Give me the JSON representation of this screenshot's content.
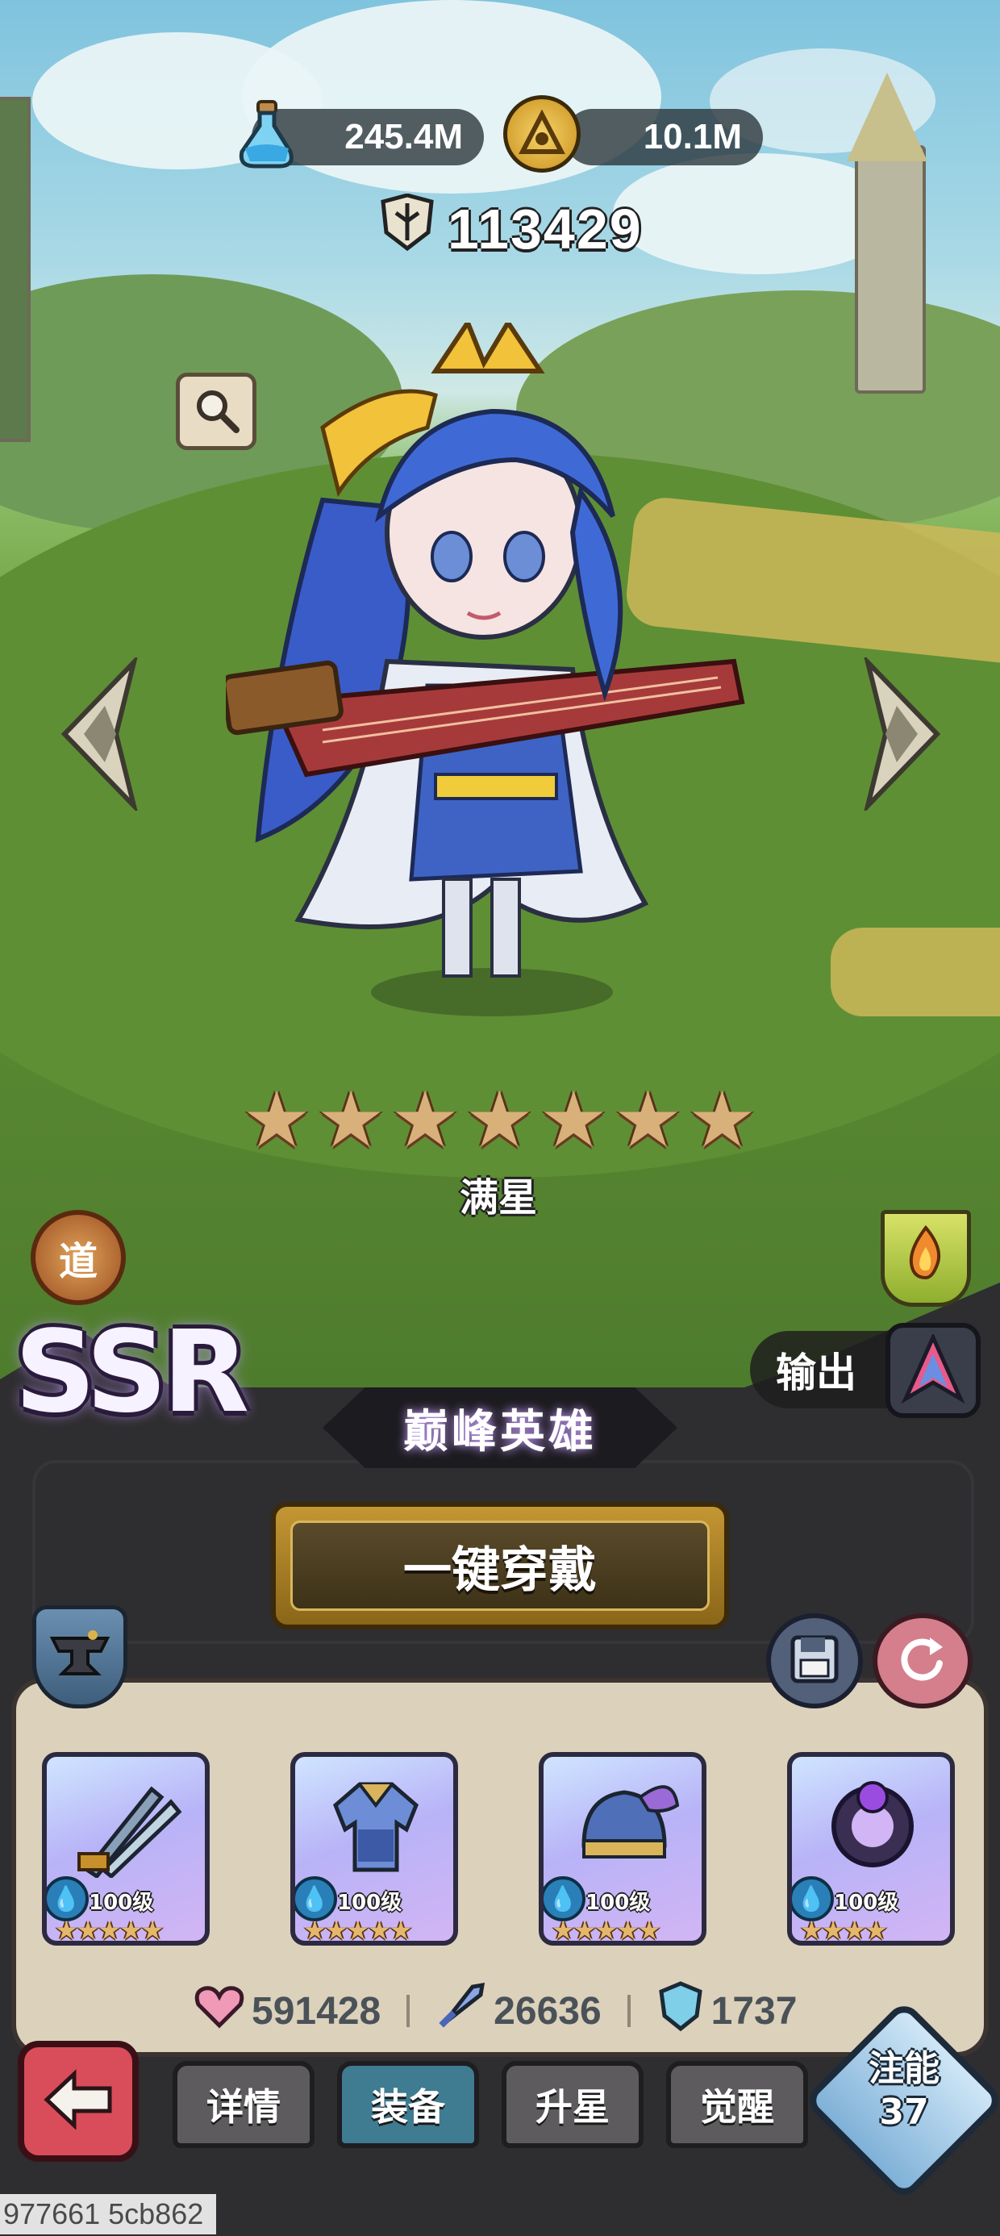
{
  "resources": {
    "potion": {
      "value": "245.4M",
      "icon": "potion-flask-icon"
    },
    "coin": {
      "value": "10.1M",
      "icon": "gold-coin-icon"
    }
  },
  "power": {
    "value": "113429",
    "icon": "power-crest-icon"
  },
  "hero": {
    "stars": 7,
    "star_label": "满星",
    "rarity": "SSR",
    "faction_badge": "道",
    "role_label": "输出",
    "title_banner": "巅峰英雄"
  },
  "actions": {
    "equip_all_label": "一键穿戴"
  },
  "equipment": [
    {
      "name": "weapon",
      "level": "100级",
      "stars": 5,
      "drop_icon": "water-drop-icon"
    },
    {
      "name": "armor",
      "level": "100级",
      "stars": 5,
      "drop_icon": "water-drop-icon"
    },
    {
      "name": "helmet",
      "level": "100级",
      "stars": 5,
      "drop_icon": "water-drop-icon"
    },
    {
      "name": "accessory",
      "level": "100级",
      "stars": 4,
      "drop_icon": "water-drop-icon"
    }
  ],
  "stats": {
    "hp": "591428",
    "attack": "26636",
    "defense": "1737"
  },
  "tabs": [
    {
      "label": "详情",
      "active": false
    },
    {
      "label": "装备",
      "active": true
    },
    {
      "label": "升星",
      "active": false
    },
    {
      "label": "觉醒",
      "active": false
    }
  ],
  "awaken": {
    "label": "注能",
    "value": "37"
  },
  "footer": {
    "id_text": "977661 5cb862"
  },
  "colors": {
    "active_tab": "#3f7b91",
    "inactive_tab": "#5d5b5d",
    "equip_button": "#c49634",
    "panel": "#dcd1bb"
  }
}
